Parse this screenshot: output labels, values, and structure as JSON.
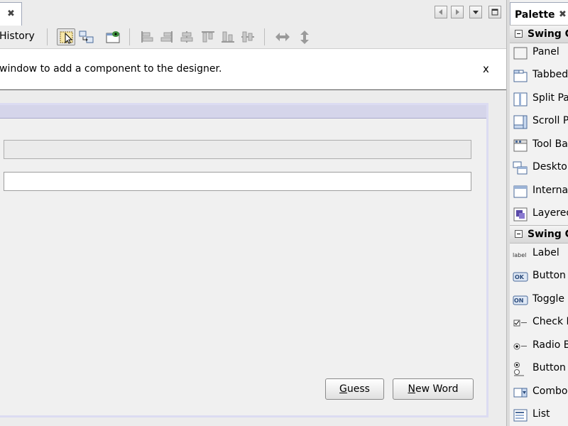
{
  "history_label": "History",
  "notice": {
    "text": "window to add a component to the designer.",
    "close": "x"
  },
  "form": {
    "guess_first": "G",
    "guess_rest": "uess",
    "newword_first": "N",
    "newword_rest": "ew Word"
  },
  "palette": {
    "title": "Palette",
    "categories": [
      "Swing C",
      "Swing C"
    ],
    "containers": [
      "Panel",
      "Tabbed",
      "Split Pa",
      "Scroll Pa",
      "Tool Ba",
      "Desktop",
      "Interna",
      "Layered"
    ],
    "controls": [
      "Label",
      "Button",
      "Toggle B",
      "Check B",
      "Radio B",
      "Button G",
      "Combo",
      "List"
    ],
    "icon_texts": {
      "label": "label",
      "ok": "OK",
      "on": "ON"
    }
  },
  "colors": {
    "toolbar_bg": "#ececec",
    "design_header": "#d5d5ea",
    "selection_border": "#dcdcf2"
  }
}
